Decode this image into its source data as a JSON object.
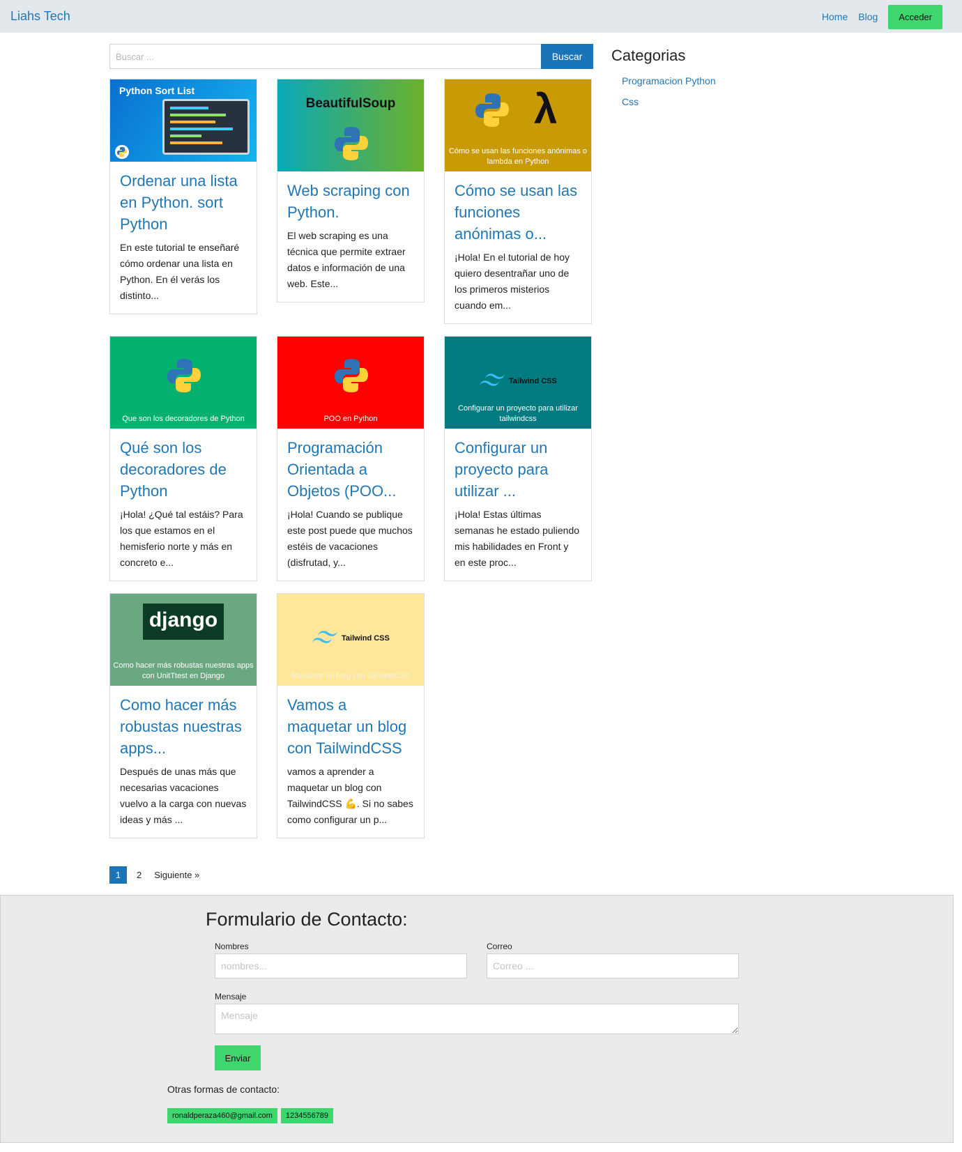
{
  "nav": {
    "brand": "Liahs Tech",
    "links": [
      "Home",
      "Blog"
    ],
    "access": "Acceder"
  },
  "search": {
    "placeholder": "Buscar ...",
    "button": "Buscar"
  },
  "sidebar": {
    "title": "Categorias",
    "items": [
      "Programacion Python",
      "Css"
    ]
  },
  "posts": [
    {
      "title": "Ordenar una lista en Python. sort Python",
      "excerpt": "En este tutorial te enseñaré cómo ordenar una lista en Python. En él verás los distinto...",
      "thumb_text": "Python Sort List",
      "thumb_color": "#0e8ee0"
    },
    {
      "title": "Web scraping con Python.",
      "excerpt": "El web scraping es una técnica que permite extraer datos e información de una web. Este...",
      "thumb_text": "BeautifulSoup",
      "thumb_color": "#1aa6a0"
    },
    {
      "title": "Cómo se usan las funciones anónimas o...",
      "excerpt": "¡Hola! En el tutorial de hoy quiero desentrañar uno de los primeros misterios cuando em...",
      "thumb_text": "Cómo se usan las funciones anónimas o lambda en Python",
      "thumb_color": "#c79a06"
    },
    {
      "title": "Qué son los decoradores de Python",
      "excerpt": "¡Hola! ¿Qué tal estáis? Para los que estamos en el hemisferio norte y más en concreto e...",
      "thumb_text": "Que son los decoradores de Python",
      "thumb_color": "#05b16e"
    },
    {
      "title": "Programación Orientada a Objetos (POO...",
      "excerpt": "¡Hola! Cuando se publique este post puede que muchos estéis de vacaciones (disfrutad, y...",
      "thumb_text": "POO en Python",
      "thumb_color": "#ff0000"
    },
    {
      "title": "Configurar un proyecto para utilizar ...",
      "excerpt": "¡Hola! Estas últimas semanas he estado puliendo mis habilidades en Front y en este proc...",
      "thumb_text": "Configurar un proyecto para utilizar tailwindcss",
      "thumb_brand": "Tailwind CSS",
      "thumb_color": "#017a80"
    },
    {
      "title": "Como hacer más robustas nuestras apps...",
      "excerpt": "Después de unas más que necesarias vacaciones vuelvo a la carga con nuevas ideas y más ...",
      "thumb_text": "Como hacer más robustas nuestras apps con UnitTtest en Django",
      "thumb_brand": "django",
      "thumb_color": "#6aa882"
    },
    {
      "title": "Vamos a maquetar un blog con TailwindCSS",
      "excerpt": "vamos a aprender a maquetar un blog con TailwindCSS 💪. Si no sabes como configurar un p...",
      "thumb_text": "Maquetar un blog con TailwindCSS",
      "thumb_brand": "Tailwind CSS",
      "thumb_color": "#fee79a"
    }
  ],
  "pagination": {
    "active": "1",
    "next_page": "2",
    "next_label": "Siguiente  »"
  },
  "contact": {
    "title": "Formulario de Contacto:",
    "name_label": "Nombres",
    "name_placeholder": "nombres...",
    "email_label": "Correo",
    "email_placeholder": "Correo ...",
    "message_label": "Mensaje",
    "message_placeholder": "Mensaje",
    "send": "Enviar",
    "other_label": "Otras formas de contacto:",
    "email": "ronaldperaza460@gmail.com",
    "phone": "1234556789"
  }
}
